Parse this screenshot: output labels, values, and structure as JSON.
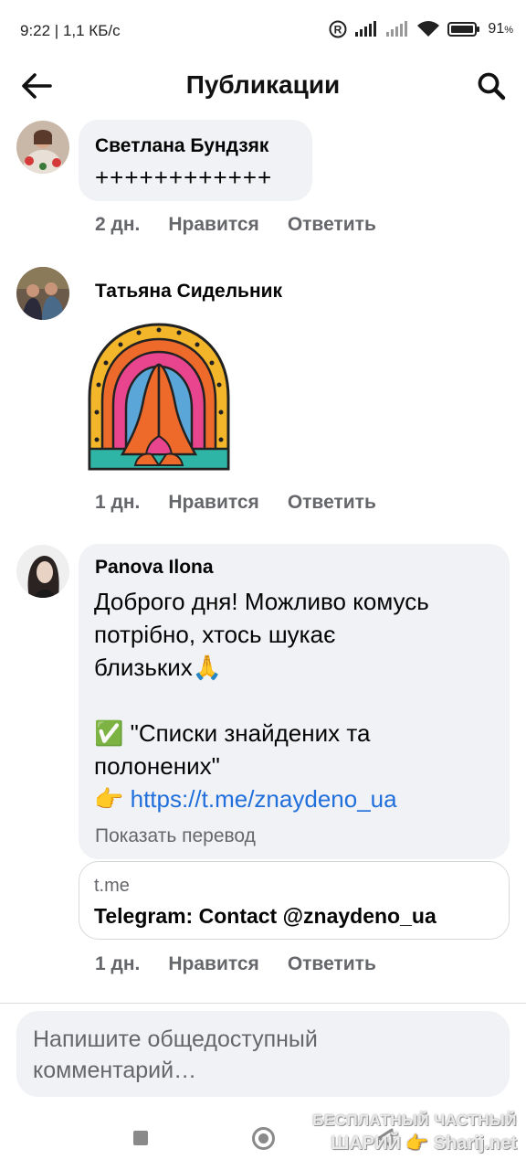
{
  "status_bar": {
    "time": "9:22 | 1,1 КБ/с",
    "battery": "91"
  },
  "header": {
    "title": "Публикации",
    "back_icon": "arrow-left-icon",
    "search_icon": "search-icon"
  },
  "comments": [
    {
      "author": "Светлана Бундзяк",
      "text": "++++++++++++",
      "time": "2 дн.",
      "like": "Нравится",
      "reply": "Ответить"
    },
    {
      "author": "Татьяна Сидельник",
      "sticker": "praying-hands-rainbow-sticker",
      "time": "1 дн.",
      "like": "Нравится",
      "reply": "Ответить"
    },
    {
      "author": "Panova Ilona",
      "text_line1": "Доброго дня! Можливо комусь",
      "text_line2": "потрібно, хтось шукає",
      "text_line3": "близьких🙏",
      "text_line4": "✅ \"Списки знайдених та",
      "text_line5": "полонених\"",
      "text_link_prefix": "👉",
      "link": "https://t.me/znaydeno_ua",
      "translate": "Показать перевод",
      "link_card": {
        "domain": "t.me",
        "title": "Telegram: Contact @znaydeno_ua"
      },
      "time": "1 дн.",
      "like": "Нравится",
      "reply": "Ответить"
    }
  ],
  "composer": {
    "placeholder": "Напишите общедоступный комментарий…"
  },
  "watermark": {
    "line1": "БЕСПЛАТНЫЙ ЧАСТНЫЙ",
    "line2": "ШАРИЙ 👉 Sharij.net"
  }
}
